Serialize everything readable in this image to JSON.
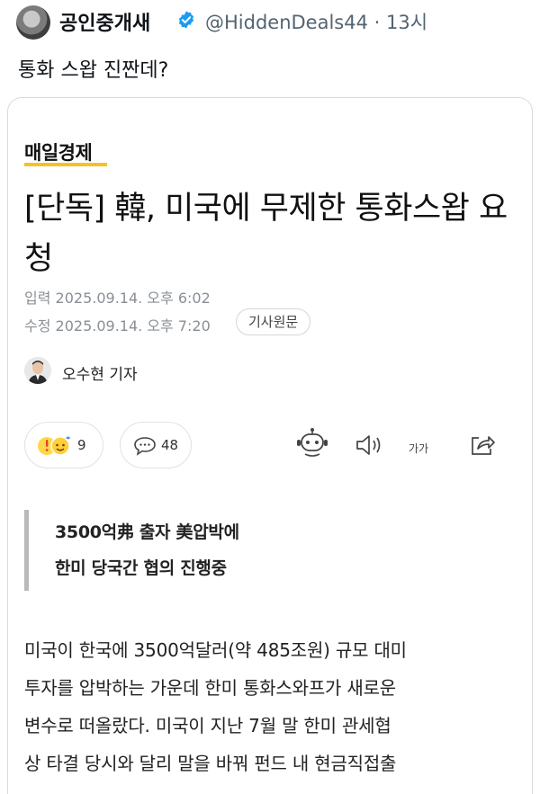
{
  "tweet": {
    "author_name": "공인중개새",
    "handle_time": "@HiddenDeals44 · 13시",
    "text": "통화 스왑 진짠데?"
  },
  "article": {
    "publisher": "매일경제",
    "headline": "[단독] 韓, 미국에 무제한 통화스왑 요청",
    "published": "입력 2025.09.14. 오후 6:02",
    "modified": "수정 2025.09.14. 오후 7:20",
    "original_button": "기사원문",
    "reporter": "오수현 기자",
    "reaction_count": "9",
    "comment_count": "48",
    "font_size_button": "가가",
    "quote": [
      "3500억弗 출자 美압박에",
      "한미 당국간 협의 진행중"
    ],
    "body_lines": [
      "미국이 한국에 3500억달러(약 485조원) 규모 대미",
      "투자를 압박하는 가운데 한미 통화스와프가 새로운",
      "변수로 떠올랐다. 미국이 지난 7월 말 한미 관세협",
      "상 타결 당시와 달리 말을 바꿔 펀드 내 현금직접출"
    ]
  },
  "icons": {
    "verified": "verified-badge-icon",
    "reaction": "emoji-reaction-icon",
    "comment": "comment-bubble-icon",
    "ai": "robot-icon",
    "audio": "speaker-icon",
    "share": "share-icon"
  },
  "colors": {
    "verified": "#1d9bf0",
    "logo_underline": "#f3c325"
  }
}
